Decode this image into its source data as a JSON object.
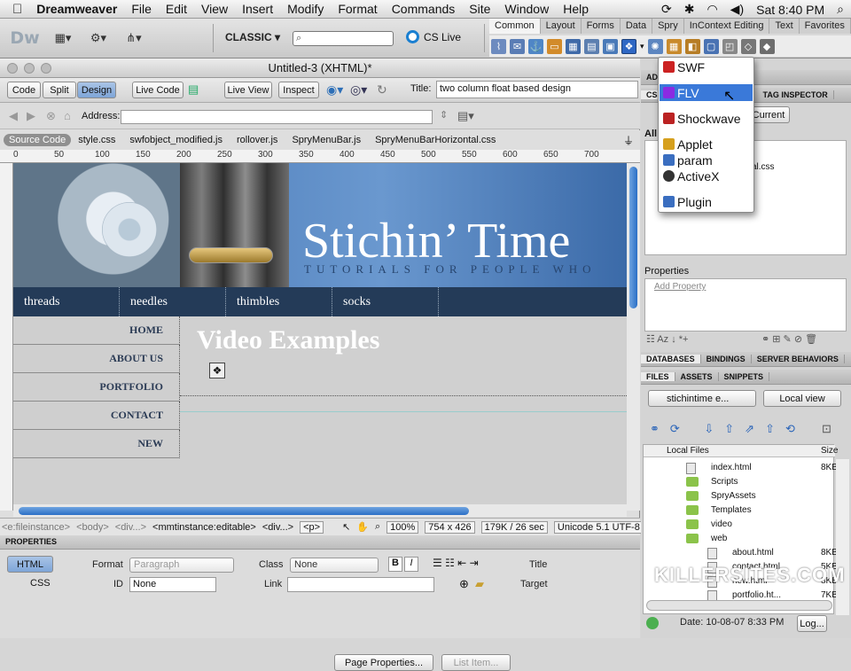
{
  "menubar": {
    "apple": "",
    "app": "Dreamweaver",
    "items": [
      "File",
      "Edit",
      "View",
      "Insert",
      "Modify",
      "Format",
      "Commands",
      "Site",
      "Window",
      "Help"
    ],
    "clock": "Sat 8:40 PM"
  },
  "appbar": {
    "logo": "Dw",
    "workspace": "CLASSIC ▾",
    "cslive": "CS Live"
  },
  "insert_panel": {
    "tabs": [
      "Common",
      "Layout",
      "Forms",
      "Data",
      "Spry",
      "InContext Editing",
      "Text",
      "Favorites"
    ],
    "active": "Common"
  },
  "document": {
    "window_title": "Untitled-3 (XHTML)*",
    "views": {
      "code": "Code",
      "split": "Split",
      "design": "Design"
    },
    "live_code": "Live Code",
    "live_view": "Live View",
    "inspect": "Inspect",
    "title_label": "Title:",
    "title_value": "two column float based design",
    "address_label": "Address:",
    "related_files": [
      "Source Code",
      "style.css",
      "swfobject_modified.js",
      "rollover.js",
      "SpryMenuBar.js",
      "SpryMenuBarHorizontal.css"
    ],
    "ruler_marks": [
      "0",
      "50",
      "100",
      "150",
      "200",
      "250",
      "300",
      "350",
      "400",
      "450",
      "500",
      "550",
      "600",
      "650",
      "700"
    ]
  },
  "page": {
    "site_title": "Stichin’ Time",
    "tagline": "TUTORIALS FOR PEOPLE WHO",
    "top_nav": [
      "threads",
      "needles",
      "thimbles",
      "socks"
    ],
    "side_nav": [
      "HOME",
      "ABOUT US",
      "PORTFOLIO",
      "CONTACT",
      "NEW"
    ],
    "heading": "Video Examples"
  },
  "tag_selector": {
    "tags": [
      "<e:fileinstance>",
      "<body>",
      "<div...>",
      "<mmtinstance:editable>",
      "<div...>",
      "<p>"
    ],
    "zoom": "100%",
    "size": "754 x 426",
    "download": "179K / 26 sec",
    "encoding": "Unicode 5.1 UTF-8"
  },
  "properties": {
    "header": "PROPERTIES",
    "html_btn": "HTML",
    "css_btn": "CSS",
    "format_label": "Format",
    "format_value": "Paragraph",
    "class_label": "Class",
    "class_value": "None",
    "id_label": "ID",
    "id_value": "None",
    "link_label": "Link",
    "title_label": "Title",
    "target_label": "Target",
    "page_props": "Page Properties...",
    "list_item": "List Item..."
  },
  "insert_dropdown": {
    "items": [
      "SWF",
      "FLV",
      "Shockwave",
      "Applet",
      "param",
      "ActiveX",
      "Plugin"
    ],
    "highlighted": "FLV"
  },
  "right_panels": {
    "css_tabs": [
      "ADOBE",
      "CSS",
      "TAG INSPECTOR"
    ],
    "current_btn": "Current",
    "all_label": "All R",
    "css_file": "al.css",
    "properties_label": "Properties",
    "add_property": "Add Property",
    "db_tabs": [
      "DATABASES",
      "BINDINGS",
      "SERVER BEHAVIORS"
    ],
    "files_tabs": [
      "FILES",
      "ASSETS",
      "SNIPPETS"
    ],
    "site": "stichintime e...",
    "view": "Local view",
    "col_files": "Local Files",
    "col_size": "Size",
    "files": [
      {
        "name": "index.html",
        "size": "8KB",
        "kind": "file",
        "indent": 0
      },
      {
        "name": "Scripts",
        "size": "",
        "kind": "folder",
        "indent": 0
      },
      {
        "name": "SpryAssets",
        "size": "",
        "kind": "folder",
        "indent": 0
      },
      {
        "name": "Templates",
        "size": "",
        "kind": "folder",
        "indent": 0
      },
      {
        "name": "video",
        "size": "",
        "kind": "folder",
        "indent": 0
      },
      {
        "name": "web",
        "size": "",
        "kind": "folder",
        "indent": 0
      },
      {
        "name": "about.html",
        "size": "8KB",
        "kind": "file",
        "indent": 1
      },
      {
        "name": "contact.html",
        "size": "5KB",
        "kind": "file",
        "indent": 1
      },
      {
        "name": "new.html",
        "size": "8KB",
        "kind": "file",
        "indent": 1
      },
      {
        "name": "portfolio.ht...",
        "size": "7KB",
        "kind": "file",
        "indent": 1
      }
    ],
    "date": "Date: 10-08-07 8:33 PM",
    "log": "Log..."
  },
  "watermark": "KILLERSITES.COM"
}
